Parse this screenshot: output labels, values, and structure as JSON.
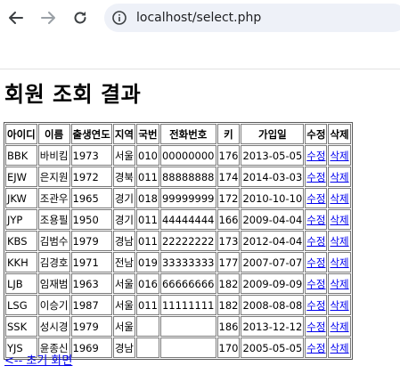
{
  "browser": {
    "url": "localhost/select.php",
    "icons": [
      "back-arrow-icon",
      "forward-arrow-icon",
      "reload-icon",
      "info-icon"
    ]
  },
  "page": {
    "title": "회원 조회 결과",
    "home_link": "<-- 초기 화면"
  },
  "table": {
    "headers": [
      "아이디",
      "이름",
      "출생연도",
      "지역",
      "국번",
      "전화번호",
      "키",
      "가입일",
      "수정",
      "삭제"
    ],
    "edit_label": "수정",
    "delete_label": "삭제",
    "rows": [
      [
        "BBK",
        "바비킴",
        "1973",
        "서울",
        "010",
        "00000000",
        "176",
        "2013-05-05"
      ],
      [
        "EJW",
        "은지원",
        "1972",
        "경북",
        "011",
        "88888888",
        "174",
        "2014-03-03"
      ],
      [
        "JKW",
        "조관우",
        "1965",
        "경기",
        "018",
        "99999999",
        "172",
        "2010-10-10"
      ],
      [
        "JYP",
        "조용필",
        "1950",
        "경기",
        "011",
        "44444444",
        "166",
        "2009-04-04"
      ],
      [
        "KBS",
        "김범수",
        "1979",
        "경남",
        "011",
        "22222222",
        "173",
        "2012-04-04"
      ],
      [
        "KKH",
        "김경호",
        "1971",
        "전남",
        "019",
        "33333333",
        "177",
        "2007-07-07"
      ],
      [
        "LJB",
        "임재범",
        "1963",
        "서울",
        "016",
        "66666666",
        "182",
        "2009-09-09"
      ],
      [
        "LSG",
        "이승기",
        "1987",
        "서울",
        "011",
        "11111111",
        "182",
        "2008-08-08"
      ],
      [
        "SSK",
        "성시경",
        "1979",
        "서울",
        "",
        "",
        "186",
        "2013-12-12"
      ],
      [
        "YJS",
        "윤종신",
        "1969",
        "경남",
        "",
        "",
        "170",
        "2005-05-05"
      ]
    ]
  }
}
